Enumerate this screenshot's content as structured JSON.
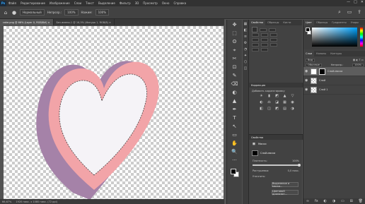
{
  "app": {
    "logo": "Ps"
  },
  "menu": [
    "Файл",
    "Редактирование",
    "Изображение",
    "Слои",
    "Текст",
    "Выделение",
    "Фильтр",
    "3D",
    "Просмотр",
    "Окно",
    "Справка"
  ],
  "window_controls": {
    "minimize": "—",
    "maximize": "□",
    "close": "✕"
  },
  "options": {
    "mode_label": "Нормальный",
    "opacity_label": "Непрозр.:",
    "opacity_value": "100%",
    "flow_label": "Нажим:",
    "flow_value": "100%"
  },
  "document_tabs": [
    {
      "label": "cake.png @ 66% (Layer 0, RGB/8#) ×",
      "active": true
    },
    {
      "label": "Без имени-1 @ 16,5% (Фигура 1, RGB/8) ×",
      "active": false
    }
  ],
  "status": {
    "zoom": "66,67%",
    "info": "1920 пикс. x 1080 пикс. (72 ppi)"
  },
  "tools": [
    "✥",
    "⬚",
    "ʘ",
    "⌖",
    "✂",
    "⊡",
    "✎",
    "⌫",
    "◐",
    "▲",
    "✒",
    "T",
    "↖",
    "▭",
    "✋",
    "🔍",
    "···"
  ],
  "side_icons": [
    "▦",
    "◧",
    "≡",
    "⚙",
    "◔",
    "✦",
    "⬡",
    "◫"
  ],
  "mid_tabs": {
    "tabs": [
      "Свойства",
      "Образцы",
      "Кисти"
    ],
    "active": 0
  },
  "adjustments": {
    "header": "Коррекция",
    "label": "Добавить корректировку",
    "icons": [
      "☀",
      "▮",
      "◩",
      "▲",
      "▽",
      "◐",
      "⚖",
      "◪",
      "▦",
      "◉",
      "◧",
      "◫",
      "◩",
      "▤",
      "◑"
    ]
  },
  "properties": {
    "header": "Свойства",
    "mask_label": "Маски",
    "layer_mask_label": "Слой-маска",
    "density_label": "Плотность:",
    "density_value": "100%",
    "feather_label": "Растушевка:",
    "feather_value": "0,0 пикс.",
    "refine_label": "Уточнить:",
    "select_mask_button": "Выделение и маска...",
    "color_range_button": "Цветовой диапазон...",
    "density_percent": 100
  },
  "color_panel": {
    "tabs": [
      "Цвет",
      "Образцы",
      "Градиенты",
      "Узоры"
    ],
    "active": 0
  },
  "layers_panel": {
    "tabs": [
      "Слои",
      "Каналы",
      "Контуры"
    ],
    "active": 0,
    "kind_label": "Вид",
    "blend_mode": "Обычные",
    "opacity_label": "Непрозр.:",
    "opacity_value": "100%",
    "lock_label": "Закрепить:",
    "fill_label": "Заливка:",
    "fill_value": "100%",
    "layers": [
      {
        "name": "Слой-маска",
        "selected": true,
        "has_mask": true
      },
      {
        "name": "Слой",
        "selected": false,
        "has_mask": false
      },
      {
        "name": "Слой 1",
        "selected": false,
        "has_mask": false
      }
    ],
    "footer_icons": [
      "∞",
      "fx",
      "◐",
      "◑",
      "▭",
      "⊞",
      "🗑"
    ]
  },
  "colors": {
    "heart_front": "#f2a4a8",
    "heart_side": "#a582a8",
    "heart_inner": "#f5f3f7"
  }
}
